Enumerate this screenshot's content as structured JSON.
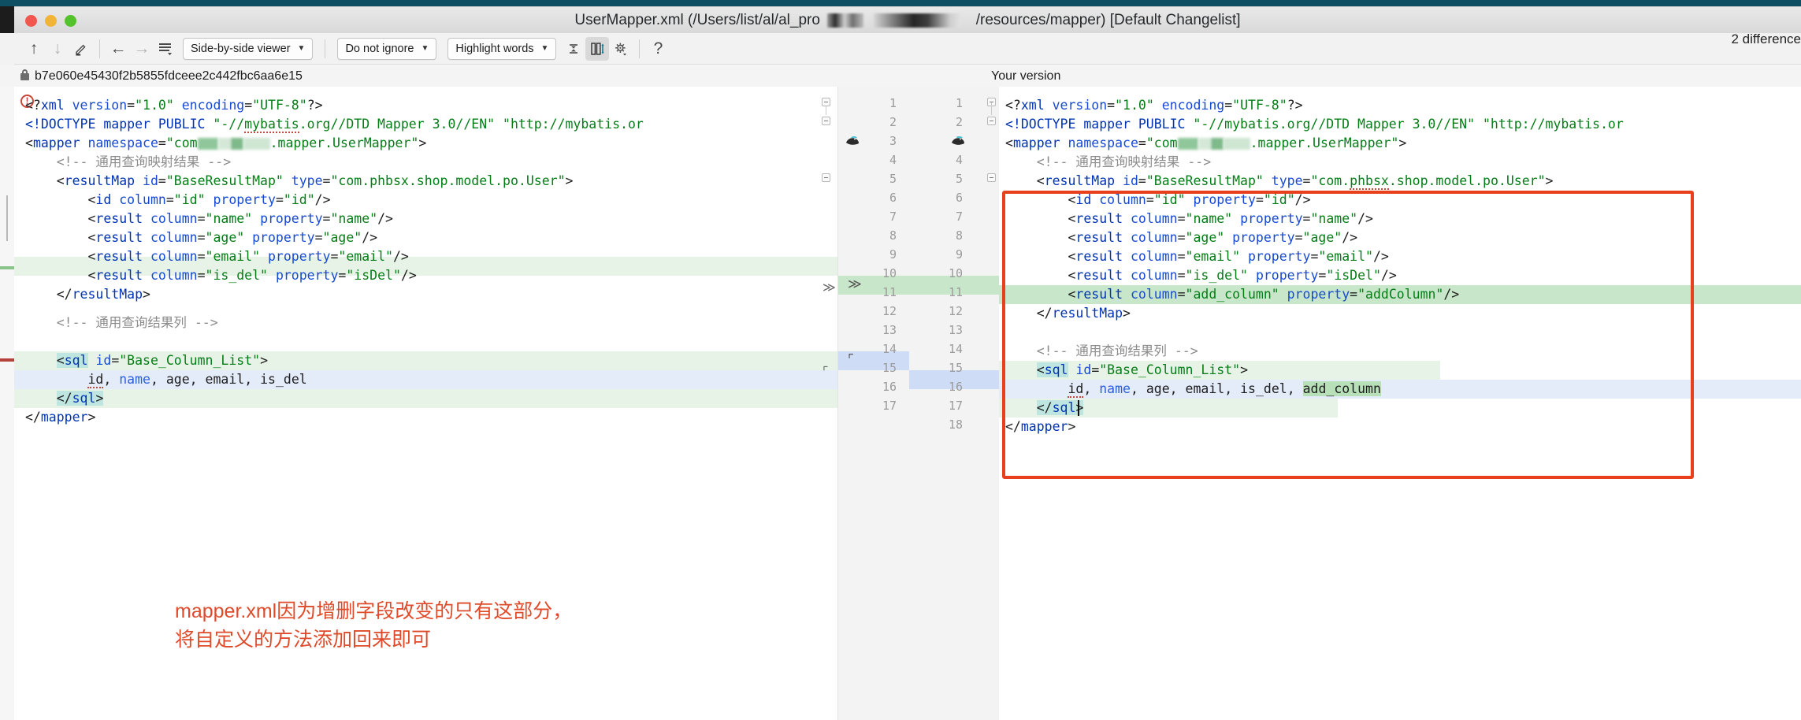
{
  "window": {
    "title_prefix": "UserMapper.xml (/Users/list/al/al_pro",
    "title_suffix": "/resources/mapper) [Default Changelist]",
    "traffic_lights": [
      "close-red",
      "minimize-yellow",
      "maximize-green"
    ]
  },
  "toolbar": {
    "prev_diff_icon": "arrow-up-icon",
    "next_diff_icon": "arrow-down-icon",
    "edit_icon": "pencil-icon",
    "apply_left_icon": "arrow-left-icon",
    "apply_right_icon": "arrow-right-icon",
    "lines_icon": "stacked-lines-icon",
    "viewer_mode": "Side-by-side viewer",
    "whitespace_mode": "Do not ignore",
    "highlight_mode": "Highlight words",
    "collapse_unchanged_icon": "collapse-unchanged-icon",
    "synchronize_icon": "sync-scroll-icon",
    "settings_icon": "gear-icon",
    "help_icon": "question-mark-icon",
    "difference_count": "2 difference"
  },
  "panels": {
    "left": {
      "header": "b7e060e45430f2b5855fdceee2c442fbc6aa6e15",
      "locked": true,
      "lock_icon": "lock-icon",
      "line_numbers": [
        1,
        2,
        3,
        4,
        5,
        6,
        7,
        8,
        9,
        10,
        11,
        12,
        13,
        14,
        15,
        16,
        17
      ],
      "lines": [
        "<?xml version=\"1.0\" encoding=\"UTF-8\"?>",
        "<!DOCTYPE mapper PUBLIC \"-//mybatis.org//DTD Mapper 3.0//EN\" \"http://mybatis.or",
        "<mapper namespace=\"com███.mapper.UserMapper\">",
        "    <!-- 通用查询映射结果 -->",
        "    <resultMap id=\"BaseResultMap\" type=\"com.phbsx.shop.model.po.User\">",
        "        <id column=\"id\" property=\"id\"/>",
        "        <result column=\"name\" property=\"name\"/>",
        "        <result column=\"age\" property=\"age\"/>",
        "        <result column=\"email\" property=\"email\"/>",
        "        <result column=\"is_del\" property=\"isDel\"/>",
        "    </resultMap>",
        "",
        "    <!-- 通用查询结果列 -->",
        "    <sql id=\"Base_Column_List\">",
        "        id, name, age, email, is_del",
        "    </sql>",
        "</mapper>"
      ]
    },
    "right": {
      "header": "Your version",
      "line_numbers": [
        1,
        2,
        3,
        4,
        5,
        6,
        7,
        8,
        9,
        10,
        11,
        12,
        13,
        14,
        15,
        16,
        17,
        18
      ],
      "lines": [
        "<?xml version=\"1.0\" encoding=\"UTF-8\"?>",
        "<!DOCTYPE mapper PUBLIC \"-//mybatis.org//DTD Mapper 3.0//EN\" \"http://mybatis.or",
        "<mapper namespace=\"com███.mapper.UserMapper\">",
        "    <!-- 通用查询映射结果 -->",
        "    <resultMap id=\"BaseResultMap\" type=\"com.phbsx.shop.model.po.User\">",
        "        <id column=\"id\" property=\"id\"/>",
        "        <result column=\"name\" property=\"name\"/>",
        "        <result column=\"age\" property=\"age\"/>",
        "        <result column=\"email\" property=\"email\"/>",
        "        <result column=\"is_del\" property=\"isDel\"/>",
        "        <result column=\"add_column\" property=\"addColumn\"/>",
        "    </resultMap>",
        "",
        "    <!-- 通用查询结果列 -->",
        "    <sql id=\"Base_Column_List\">",
        "        id, name, age, email, is_del, add_column",
        "    </sql>",
        "</mapper>"
      ]
    }
  },
  "diff": {
    "added_line_number": 11,
    "added_text": "<result column=\"add_column\" property=\"addColumn\"/>",
    "modified_line_number": 16,
    "modified_token": "add_column",
    "marker_added_icon": "chevron-double-right-icon",
    "marker_modified_icon": "arrow-corner-icon"
  },
  "annotation": {
    "text": "mapper.xml因为增删字段改变的只有这部分，\n将自定义的方法添加回来即可",
    "color": "#df4b2a",
    "box_color": "#e8401c"
  },
  "colors": {
    "added_bg": "#c8e6c9",
    "modified_bg": "#e4ecfa",
    "inline_added_bg": "#b8e0b8",
    "tag": "#0033b3",
    "attr_value": "#067d17",
    "comment": "#8c8c8c"
  }
}
